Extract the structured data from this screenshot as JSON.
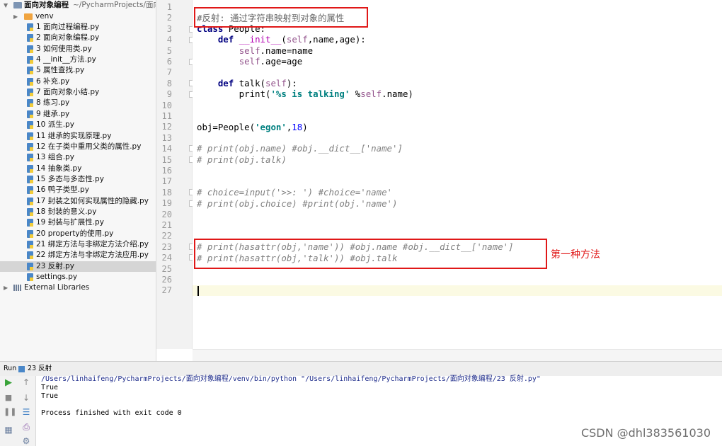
{
  "project": {
    "name": "面向对象编程",
    "path": "~/PycharmProjects/面向",
    "venv": "venv",
    "files": [
      "1 面向过程编程.py",
      "2 面向对象编程.py",
      "3 如何使用类.py",
      "4 __init__方法.py",
      "5 属性查找.py",
      "6 补充.py",
      "7 面向对象小结.py",
      "8 练习.py",
      "9 继承.py",
      "10 派生.py",
      "11 继承的实现原理.py",
      "12 在子类中重用父类的属性.py",
      "13 组合.py",
      "14 抽象类.py",
      "15 多态与多态性.py",
      "16 鸭子类型.py",
      "17 封装之如何实现属性的隐藏.py",
      "18 封装的意义.py",
      "19 封装与扩展性.py",
      "20 property的使用.py",
      "21 绑定方法与非绑定方法介绍.py",
      "22 绑定方法与非绑定方法应用.py",
      "23 反射.py",
      "settings.py"
    ],
    "selected_index": 22,
    "external_libraries": "External Libraries"
  },
  "editor": {
    "line_numbers": [
      "1",
      "2",
      "3",
      "4",
      "5",
      "6",
      "7",
      "8",
      "9",
      "10",
      "11",
      "12",
      "13",
      "14",
      "15",
      "16",
      "17",
      "18",
      "19",
      "20",
      "21",
      "22",
      "23",
      "24",
      "25",
      "26",
      "27"
    ],
    "comment_header": "#反射: 通过字符串映射到对象的属性",
    "annotation": "第一种方法"
  },
  "run": {
    "title": "Run",
    "config": "23 反射",
    "output": [
      "/Users/linhaifeng/PycharmProjects/面向对象编程/venv/bin/python \"/Users/linhaifeng/PycharmProjects/面向对象编程/23 反射.py\"",
      "True",
      "True",
      "",
      "Process finished with exit code 0"
    ]
  },
  "watermark": "CSDN @dhl383561030",
  "colors": {
    "annotation_red": "#e01818",
    "keyword": "#000080",
    "string": "#008080",
    "number": "#0000FF",
    "comment": "#808080",
    "self": "#94558D",
    "magic_method": "#B200B2",
    "selected_row": "#d5d5d5",
    "caret_row": "#fbfae3"
  },
  "icons": {
    "run": "play-icon",
    "stop": "stop-icon",
    "pause": "pause-icon",
    "up": "arrow-up-icon",
    "down": "arrow-down-icon",
    "wrap": "soft-wrap-icon",
    "print": "print-icon",
    "layout": "layout-icon",
    "file": "python-file-icon",
    "folder": "folder-icon"
  }
}
